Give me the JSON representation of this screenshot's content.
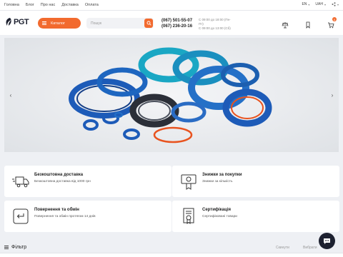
{
  "topnav": [
    "Головна",
    "Блог",
    "Про нас",
    "Доставка",
    "Оплата"
  ],
  "toolbar": {
    "language": "EN",
    "currency": "UAH"
  },
  "header": {
    "logo": "PGT",
    "catalog_label": "Каталог",
    "search_placeholder": "Пошук",
    "phones": [
      "(067) 501-55-07",
      "(067) 236-20-16"
    ],
    "hours": [
      "С 09:00 до 18:00 (Пн-Пт)",
      "С 09:00 до 13:00 (Сб)"
    ],
    "cart_count": "0"
  },
  "features": [
    {
      "title": "Безкоштовна доставка",
      "subtitle": "Безкоштовна доставка від 1000 грн",
      "icon": "truck-icon"
    },
    {
      "title": "Знижки за покупки",
      "subtitle": "Знижки за кількість",
      "icon": "discount-tag-icon"
    },
    {
      "title": "Повернення та обмін",
      "subtitle": "Повернення та обмін протягом 14 днів",
      "icon": "return-icon"
    },
    {
      "title": "Сертифікація",
      "subtitle": "Сертифіковані товари",
      "icon": "certificate-icon"
    }
  ],
  "filter": {
    "title": "Фільтр",
    "reset": "Скинути",
    "sort": "Вибрати"
  },
  "colors": {
    "accent": "#f26a2e",
    "dark": "#1d2130",
    "seal_blue": "#1f5fb5",
    "seal_teal": "#1aa7c4",
    "seal_orange": "#e8531f"
  }
}
